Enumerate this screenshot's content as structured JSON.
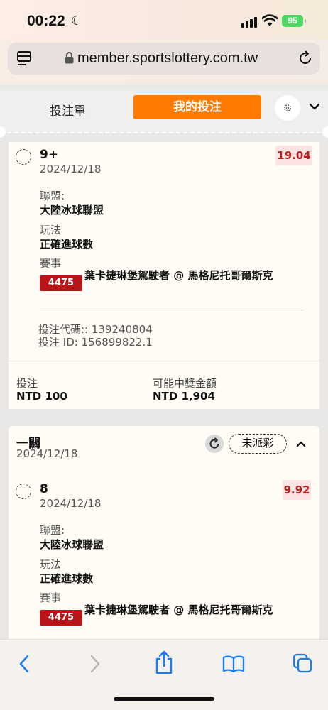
{
  "status_bar": {
    "time": "00:22",
    "battery": "95"
  },
  "browser": {
    "url": "member.sportslottery.com.tw"
  },
  "panel": {
    "tab_betslip": "投注單",
    "tab_mybets": "我的投注"
  },
  "bet1": {
    "selection": "9+",
    "date": "2024/12/18",
    "odds": "19.04",
    "league_label": "聯盟:",
    "league": "大陸冰球聯盟",
    "market_label": "玩法",
    "market": "正確進球數",
    "event_label": "賽事",
    "event_code": "4475",
    "event_name": "葉卡捷琳堡駕駛者 @ 馬格尼托哥爾斯克",
    "bet_code": "投注代碼:: 139240804",
    "bet_id": "投注 ID: 156899822.1",
    "stake_label": "投注",
    "stake": "NTD 100",
    "payout_label": "可能中獎金額",
    "payout": "NTD 1,904"
  },
  "bet2": {
    "type": "一關",
    "date": "2024/12/18",
    "status": "未派彩",
    "selection": "8",
    "sel_date": "2024/12/18",
    "odds": "9.92",
    "league_label": "聯盟:",
    "league": "大陸冰球聯盟",
    "market_label": "玩法",
    "market": "正確進球數",
    "event_label": "賽事",
    "event_code": "4475",
    "event_name": "葉卡捷琳堡駕駛者 @ 馬格尼托哥爾斯克"
  },
  "colors": {
    "accent": "#ff7a00",
    "odds_text": "#c01f1f",
    "event_badge": "#b8141a",
    "ios_blue": "#1a7cf0"
  }
}
